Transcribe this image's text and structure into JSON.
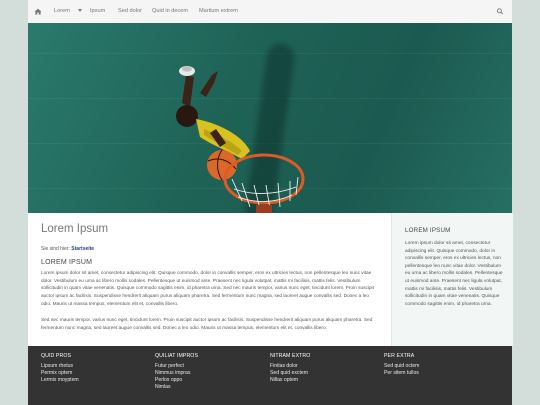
{
  "nav": {
    "items": [
      "Lorem",
      "Ipsum",
      "Sed dolor",
      "Quid in decem",
      "Martium extrem"
    ],
    "home_icon": "home-icon",
    "search_icon": "search-icon"
  },
  "hero": {
    "image": "overhead basketball player dunking"
  },
  "main": {
    "title": "Lorem Ipsum",
    "breadcrumb_label": "Sie sind hier:",
    "breadcrumb_link": "Startseite",
    "subheading": "LOREM IPSUM",
    "paragraph1": "Lorem ipsum dolor sit amet, consectetur adipiscing elit. Quisque commodo, dolor in convallis semper, eros ex ultricies lectus, non pellentesque leo nunc vitae dolor. Vestibulum eu urna ac libero mollis sodales. Pellentesque ut euismod ante. Praesent nec ligula volutpat, mattis mi facilisis, mattis felis. Vestibulum sollicitudin in quam vitae venenatis. Quisque commodo sagittis enim, id pharetra urna. Sed nec mauris tempor, varius nunc eget, tincidunt lorem. Proin suscipit auctor ipsum ac facilisis. Suspendisse hendrerit aliquam purus aliquam pharetra. Sed fermentum nunc magna, sed laoreet augue convallis sed. Donec a leo odio. Mauris ut massa tempus, elementum elit et, convallis libero.",
    "paragraph2": "Sed nec mauris tempor, varius nunc eget, tincidunt lorem. Proin suscipit auctor ipsum ac facilisis. Suspendisse hendrerit aliquam purus aliquam pharetra. Sed fermentum nunc magna, sed laoreet augue convallis sed. Donec a leo odio. Mauris ut massa tempus, elementum elit et, convallis libero."
  },
  "aside": {
    "heading": "LOREM IPSUM",
    "text": "Lorem ipsum dolor sit amet, consectetur adipiscing elit. Quisque commodo, dolor in convallis semper, eros ex ultricies lectus, non pellentesque leo nunc vitae dolor. Vestibulum eu urna ac libero mollis sodales. Pellentesque ut euismod ante. Praesent nec ligula volutpat, mattis mi facilisis, mattis felis. Vestibulum sollicitudin in quam vitae venenatis. Quisque commodo sagittis enim, id pharetra urna."
  },
  "footer": {
    "columns": [
      {
        "heading": "QUID PROS",
        "links": [
          "Lipsum rhetus",
          "Permix optem",
          "Lermix moyptem"
        ]
      },
      {
        "heading": "QUILIAT IMPROS",
        "links": [
          "Futur perfect",
          "Nimmus impras",
          "Perlox oppo",
          "Nimlas"
        ]
      },
      {
        "heading": "NITRAM EXTRO",
        "links": [
          "Finitas dolor",
          "Sed quid exctem",
          "Nillas optem"
        ]
      },
      {
        "heading": "PER EXTRA",
        "links": [
          "Sed quid octem",
          "Per sitem tullos"
        ]
      }
    ]
  },
  "colors": {
    "page_bg": "#d3dedb",
    "nav_bg": "#f5f5f5",
    "hero_court": "#1f6357",
    "footer_bg": "#333333",
    "link": "#2c3e86",
    "aside_bg": "#f2f7f5"
  }
}
